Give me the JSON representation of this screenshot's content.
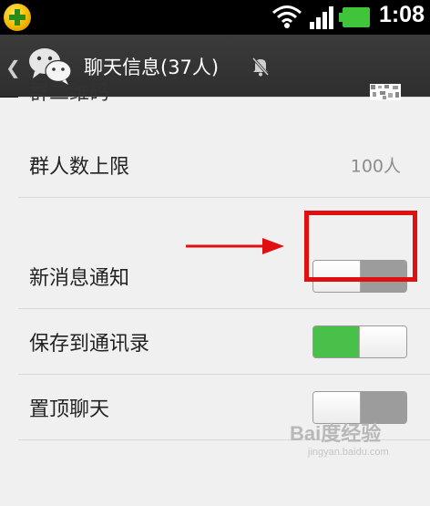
{
  "status_bar": {
    "time": "1:08",
    "icons": [
      "app-360-icon",
      "wifi-icon",
      "signal-icon",
      "battery-icon"
    ],
    "battery_color": "#3fc43a"
  },
  "header": {
    "back_icon": "chevron-left-icon",
    "app_icon": "wechat-icon",
    "title": "聊天信息(37人)",
    "mute_icon": "mute-bell-icon"
  },
  "settings": {
    "group_qr": {
      "label": "群二维码",
      "icon": "qr-code-icon"
    },
    "group_limit": {
      "label": "群人数上限",
      "value": "100人"
    },
    "new_message_notify": {
      "label": "新消息通知",
      "enabled": false
    },
    "save_to_contacts": {
      "label": "保存到通讯录",
      "enabled": true
    },
    "pin_chat": {
      "label": "置顶聊天",
      "enabled": false
    }
  },
  "annotation": {
    "highlight_color": "#e01010",
    "arrow_color": "#e01010"
  },
  "watermark": {
    "brand": "Bai度经验",
    "url": "jingyan.baidu.com"
  },
  "colors": {
    "toggle_on": "#49c04a",
    "toggle_off": "#9c9c9c",
    "title_bar": "#333333"
  }
}
